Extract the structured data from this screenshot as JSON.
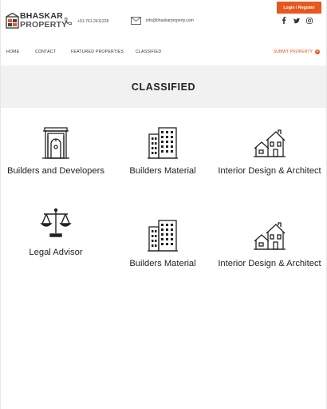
{
  "header": {
    "login_label": "Login / Register",
    "logo_line1": "BHASKAR",
    "logo_line2": "PROPERTY",
    "phone": "+91-761-2411228",
    "email": "info@bhaskarproperty.com"
  },
  "nav": {
    "items": [
      "HOME",
      "CONTACT",
      "FEATURED PROPERTIES",
      "CLASSIFIED"
    ],
    "submit_label": "SUBMIT PROPERTY",
    "submit_icon_glyph": "+"
  },
  "banner": {
    "title": "CLASSIFIED"
  },
  "categories": [
    {
      "label": "Builders and Developers",
      "icon": "building-entrance-icon"
    },
    {
      "label": "Builders Material",
      "icon": "office-building-icon"
    },
    {
      "label": "Interior Design & Architect",
      "icon": "houses-icon"
    },
    {
      "label": "Legal Advisor",
      "icon": "balance-scale-icon"
    },
    {
      "label": "Builders Material",
      "icon": "office-building-icon"
    },
    {
      "label": "Interior Design & Architect",
      "icon": "houses-icon"
    }
  ],
  "colors": {
    "accent": "#e8571e",
    "banner_bg": "#f1f1f1"
  }
}
